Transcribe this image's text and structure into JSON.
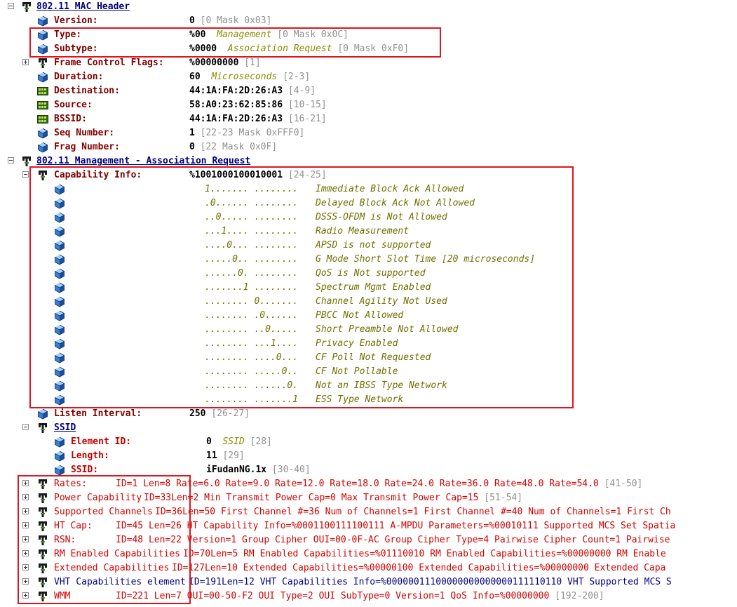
{
  "mac_header": {
    "title": "802.11 MAC Header",
    "fields": [
      {
        "label": "Version:",
        "value": "0",
        "desc": "",
        "range": "[0 Mask 0x03]"
      },
      {
        "label": "Type:",
        "value": "%00",
        "desc": "Management",
        "range": "[0 Mask 0x0C]"
      },
      {
        "label": "Subtype:",
        "value": "%0000",
        "desc": "Association Request",
        "range": "[0 Mask 0xF0]"
      },
      {
        "label": "Frame Control Flags:",
        "value": "%00000000",
        "desc": "",
        "range": "[1]"
      },
      {
        "label": "Duration:",
        "value": "60",
        "desc": "Microseconds",
        "range": "[2-3]"
      },
      {
        "label": "Destination:",
        "value": "44:1A:FA:2D:26:A3",
        "desc": "",
        "range": "[4-9]"
      },
      {
        "label": "Source:",
        "value": "58:A0:23:62:85:86",
        "desc": "",
        "range": "[10-15]"
      },
      {
        "label": "BSSID:",
        "value": "44:1A:FA:2D:26:A3",
        "desc": "",
        "range": "[16-21]"
      },
      {
        "label": "Seq Number:",
        "value": "1",
        "desc": "",
        "range": "[22-23 Mask 0xFFF0]"
      },
      {
        "label": "Frag Number:",
        "value": "0",
        "desc": "",
        "range": "[22 Mask 0x0F]"
      }
    ]
  },
  "management": {
    "title": "802.11 Management - Association Request",
    "capability": {
      "label": "Capability Info:",
      "value": "%1001000100010001",
      "range": "[24-25]",
      "bits": [
        {
          "bits": "1....... ........",
          "desc": "Immediate Block Ack Allowed"
        },
        {
          "bits": ".0...... ........",
          "desc": "Delayed Block Ack Not Allowed"
        },
        {
          "bits": "..0..... ........",
          "desc": "DSSS-OFDM is Not Allowed"
        },
        {
          "bits": "...1.... ........",
          "desc": "Radio Measurement"
        },
        {
          "bits": "....0... ........",
          "desc": "APSD is not supported"
        },
        {
          "bits": ".....0.. ........",
          "desc": "G Mode Short Slot Time [20 microseconds]"
        },
        {
          "bits": "......0. ........",
          "desc": "QoS is Not supported"
        },
        {
          "bits": ".......1 ........",
          "desc": "Spectrum Mgmt Enabled"
        },
        {
          "bits": "........ 0.......",
          "desc": "Channel Agility Not Used"
        },
        {
          "bits": "........ .0......",
          "desc": "PBCC Not Allowed"
        },
        {
          "bits": "........ ..0.....",
          "desc": "Short Preamble Not Allowed"
        },
        {
          "bits": "........ ...1....",
          "desc": "Privacy Enabled"
        },
        {
          "bits": "........ ....0...",
          "desc": "CF Poll Not Requested"
        },
        {
          "bits": "........ .....0..",
          "desc": "CF Not Pollable"
        },
        {
          "bits": "........ ......0.",
          "desc": "Not an IBSS Type Network"
        },
        {
          "bits": "........ .......1",
          "desc": "ESS Type Network"
        }
      ]
    },
    "listen_interval": {
      "label": "Listen Interval:",
      "value": "250",
      "range": "[26-27]"
    },
    "ssid": {
      "title": "SSID",
      "fields": [
        {
          "label": "Element ID:",
          "value": "0",
          "desc": "SSID",
          "range": "[28]"
        },
        {
          "label": "Length:",
          "value": "11",
          "desc": "",
          "range": "[29]"
        },
        {
          "label": "SSID:",
          "value": "iFudanNG.1x",
          "desc": "",
          "range": "[30-40]"
        }
      ]
    },
    "elements": [
      {
        "label": "Rates:",
        "detail": "ID=1 Len=8 Rate=6.0 Rate=9.0 Rate=12.0 Rate=18.0 Rate=24.0 Rate=36.0 Rate=48.0 Rate=54.0",
        "range": "[41-50]",
        "color": "red"
      },
      {
        "label": "Power Capability",
        "detail": "ID=33Len=2 Min Transmit Power Cap=0 Max Transmit Power Cap=15",
        "range": "[51-54]",
        "color": "red"
      },
      {
        "label": "Supported Channels",
        "detail": "ID=36Len=50 First Channel #=36 Num of Channels=1 First Channel #=40 Num of Channels=1 First Ch",
        "range": "",
        "color": "red"
      },
      {
        "label": "HT Cap:",
        "detail": "ID=45 Len=26 HT Capability Info=%0001100111100111 A-MPDU Parameters=%00010111 Supported MCS Set Spatia",
        "range": "",
        "color": "red"
      },
      {
        "label": "RSN:",
        "detail": "ID=48 Len=22 Version=1 Group Cipher OUI=00-0F-AC Group Cipher Type=4 Pairwise Cipher Count=1 Pairwise",
        "range": "",
        "color": "red"
      },
      {
        "label": "RM Enabled Capabilities",
        "detail": "ID=70Len=5 RM Enabled Capabilities=%01110010 RM Enabled Capabilities=%00000000 RM Enable",
        "range": "",
        "color": "red"
      },
      {
        "label": "Extended Capabilities",
        "detail": "ID=127Len=10 Extended Capabilities=%00000100 Extended Capabilities=%00000000 Extended Capa",
        "range": "",
        "color": "red"
      },
      {
        "label": "VHT Capabilities element",
        "detail": "ID=191Len=12 VHT Capabilities Info=%00000011100000000000000111110110 VHT Supported MCS S",
        "range": "",
        "color": "blue"
      },
      {
        "label": "WMM",
        "detail": "ID=221 Len=7 OUI=00-50-F2 OUI Type=2 OUI SubType=0 Version=1 QoS Info=%00000000",
        "range": "[192-200]",
        "color": "red"
      }
    ]
  },
  "icons": {
    "expander": "tree-expander-icon",
    "branch": "protocol-branch-icon",
    "cube": "field-cube-icon",
    "address": "network-address-icon"
  },
  "colors": {
    "highlight": "#e0141e",
    "header": "#000080",
    "label": "#800000",
    "element": "#d40000",
    "description": "#8a8a00",
    "range": "#909090"
  }
}
